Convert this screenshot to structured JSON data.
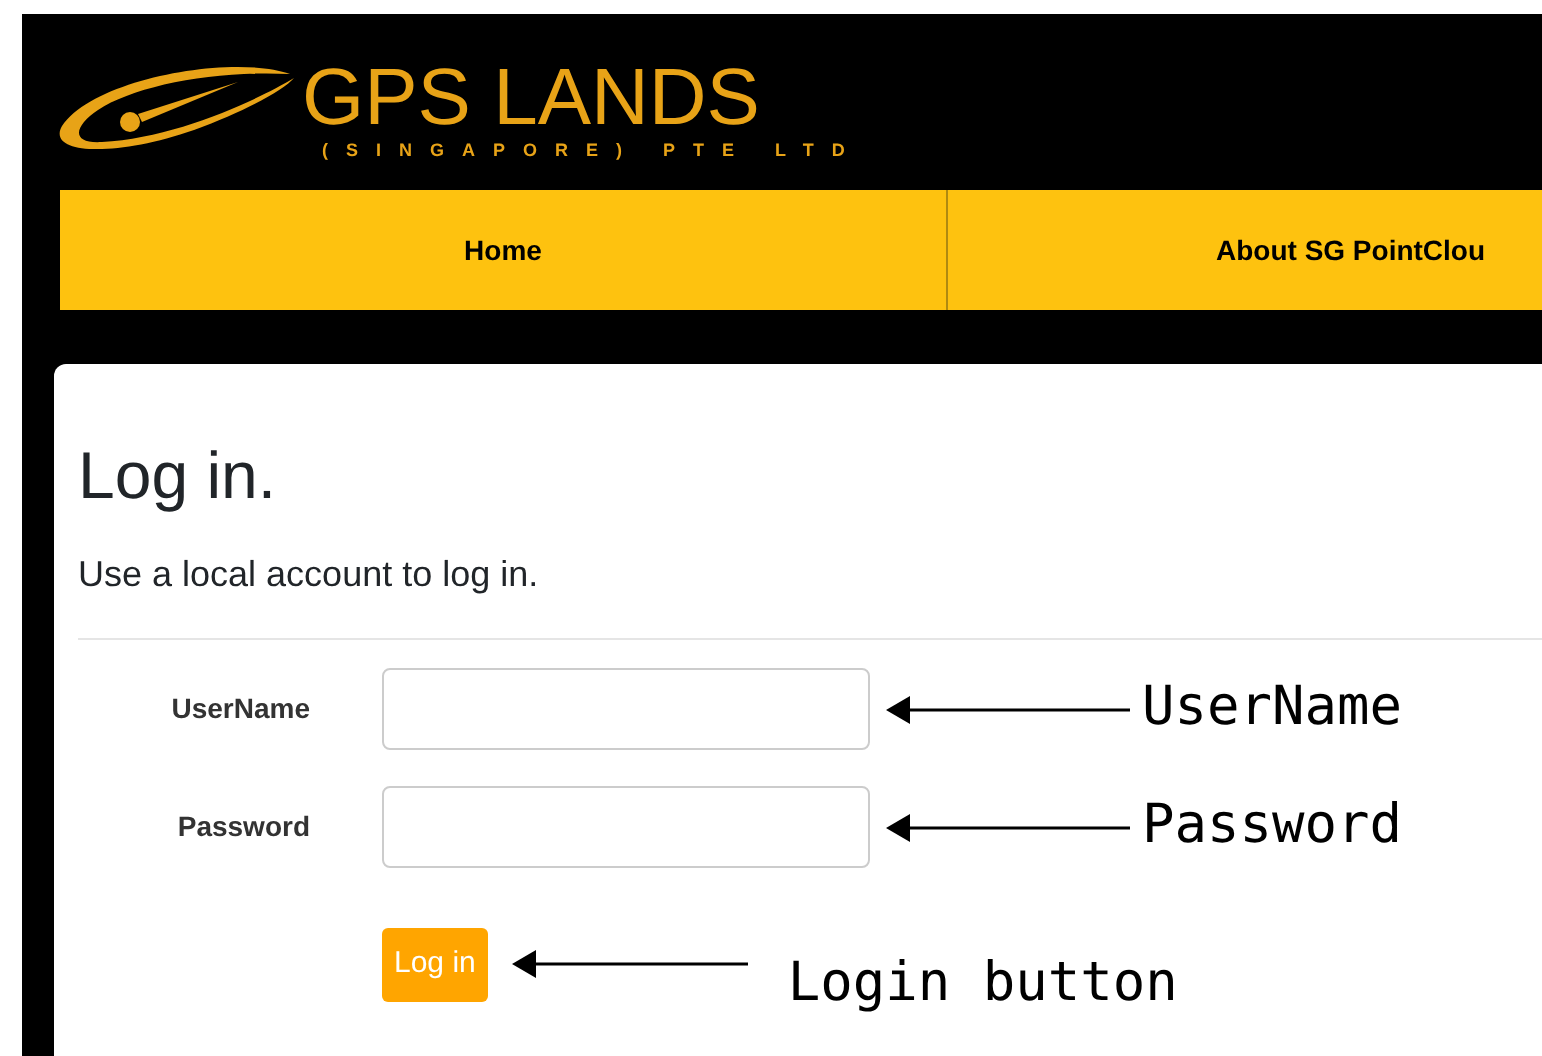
{
  "header": {
    "logo_title": "GPS LANDS",
    "logo_subtitle": "(SINGAPORE) PTE LTD"
  },
  "nav": [
    {
      "label": "Home"
    },
    {
      "label": "About SG PointClou"
    }
  ],
  "login": {
    "title": "Log in.",
    "subtitle": "Use a local account to log in.",
    "fields": [
      {
        "label": "UserName",
        "annotation": "UserName"
      },
      {
        "label": "Password",
        "annotation": "Password"
      }
    ],
    "button": {
      "label": "Log in",
      "annotation": "Login button"
    }
  }
}
